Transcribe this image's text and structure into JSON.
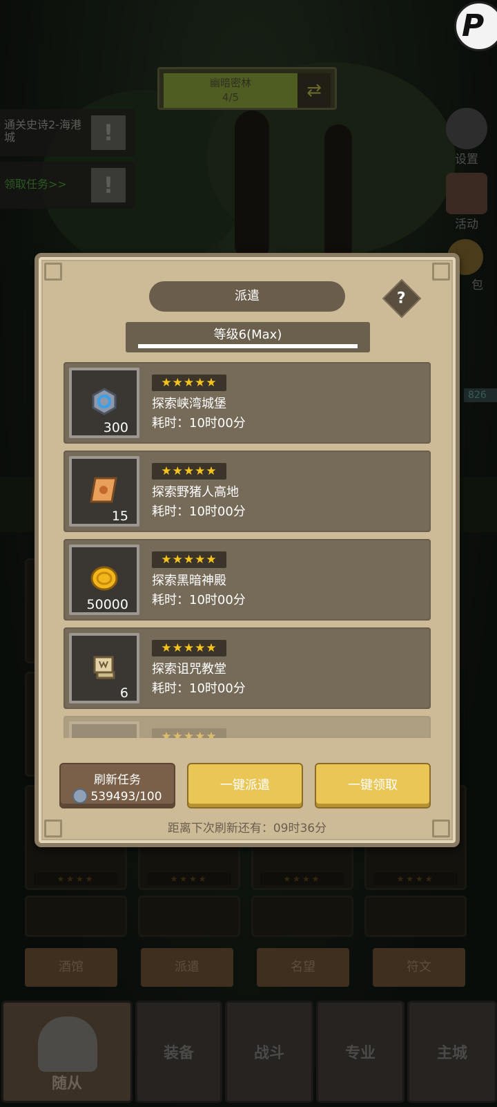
{
  "stage": {
    "name": "幽暗密林",
    "progress": "4/5"
  },
  "quests": [
    {
      "text": "通关史诗2-海港城",
      "icon": "exclamation-icon"
    },
    {
      "text": "领取任务>>",
      "icon": "exclamation-icon"
    }
  ],
  "side_menu": {
    "settings": "设置",
    "events": "活动",
    "bag": "包"
  },
  "side_counter": "826",
  "modal": {
    "title": "派遣",
    "help": "?",
    "level": "等级6(Max)",
    "level_progress": 1.0,
    "missions": [
      {
        "stars": "★★★★★",
        "title": "探索峡湾城堡",
        "time": "耗时：10时00分",
        "reward_qty": "300",
        "reward_icon": "gem-icon"
      },
      {
        "stars": "★★★★★",
        "title": "探索野猪人高地",
        "time": "耗时：10时00分",
        "reward_qty": "15",
        "reward_icon": "scroll-icon"
      },
      {
        "stars": "★★★★★",
        "title": "探索黑暗神殿",
        "time": "耗时：10时00分",
        "reward_qty": "50000",
        "reward_icon": "gold-coin-icon"
      },
      {
        "stars": "★★★★★",
        "title": "探索诅咒教堂",
        "time": "耗时：10时00分",
        "reward_qty": "6",
        "reward_icon": "rune-scroll-icon"
      },
      {
        "stars": "★★★★★",
        "title": "",
        "time": "",
        "reward_qty": "",
        "reward_icon": ""
      }
    ],
    "refresh_button": {
      "label": "刷新任务",
      "cost": "539493/100"
    },
    "dispatch_all": "一键派遣",
    "claim_all": "一键领取",
    "next_refresh": "距离下次刷新还有：09时36分"
  },
  "sub_tabs": [
    "酒馆",
    "派遣",
    "名望",
    "符文"
  ],
  "bottom_nav": [
    "随从",
    "装备",
    "战斗",
    "专业",
    "主城"
  ],
  "colors": {
    "gold_button": "#e9c656",
    "parchment": "#cdbb98",
    "mission_card": "#766a58",
    "star": "#f5c51e"
  }
}
